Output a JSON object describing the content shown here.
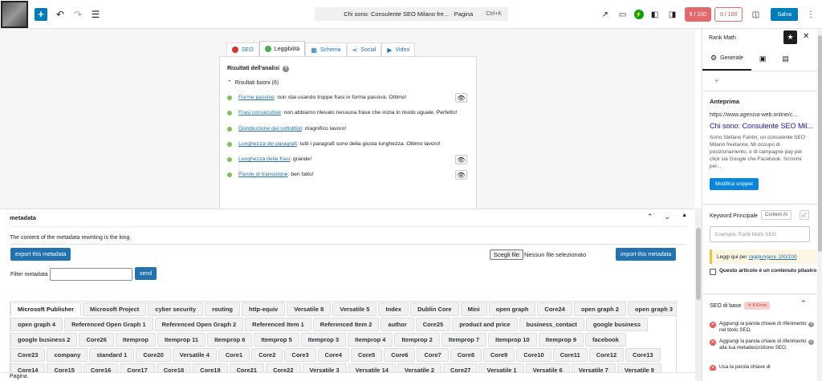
{
  "topbar": {
    "doc_title": "Chi sono: Consulente SEO Milano fre... · Pagina",
    "shortcut": "Ctrl+K",
    "seo_score": "9 / 100",
    "read_score": "0 / 100",
    "save_label": "Salva"
  },
  "analysis": {
    "tabs": [
      {
        "label": "SEO"
      },
      {
        "label": "Leggibilità"
      },
      {
        "label": "Schema"
      },
      {
        "label": "Social"
      },
      {
        "label": "Video"
      }
    ],
    "title": "Risultati dell'analisi",
    "group": "Risultati buoni (6)",
    "results": [
      {
        "link": "Forme passive",
        "text": ": non stai usando troppe frasi in forma passiva. Ottimo!"
      },
      {
        "link": "Frasi consecutive",
        "text": ": non abbiamo rilevato nessuna frase che inizia in modo uguale. Perfetto!"
      },
      {
        "link": "Distribuzione dei sottotitoli",
        "text": ": magnifico lavoro!"
      },
      {
        "link": "Lunghezza dei paragrafi",
        "text": ": tutti i paragrafi sono della giusta lunghezza. Ottimo lavoro!"
      },
      {
        "link": "Lunghezza delle frasi",
        "text": ": grande!"
      },
      {
        "link": "Parole di transizione",
        "text": ": ben fatto!"
      }
    ]
  },
  "metabox": {
    "title": "metadata",
    "description": "The content of the metadata rewriting is the king.",
    "export_label": "export this metadata",
    "file_button": "Scegli file",
    "file_text": "Nessun file selezionato",
    "import_label": "import this metadata",
    "filter_label": "Filter metadata",
    "send_label": "send",
    "tag_rows": [
      [
        "Microsoft Publisher",
        "Microsoft Project",
        "cyber security",
        "routing",
        "http-equiv",
        "Versatile 8",
        "Versatile 5",
        "Index",
        "Dublin Core",
        "Mini",
        "open graph",
        "Core24",
        "open graph 2",
        "open graph 3"
      ],
      [
        "open graph 4",
        "Referenced Open Graph 1",
        "Referenced Open Graph 2",
        "Referenced Item 1",
        "Referenced Item 2",
        "author",
        "Core25",
        "product and price",
        "business_contact",
        "google business"
      ],
      [
        "google business 2",
        "Core26",
        "Itemprop",
        "Itemprop 11",
        "Itemprop 6",
        "Itemprop 5",
        "Itemprop 3",
        "Itemprop 4",
        "Itemprop 2",
        "Itemprop 7",
        "Itemprop 10",
        "Itemprop 9",
        "facebook"
      ],
      [
        "Core23",
        "company",
        "standard 1",
        "Core20",
        "Versatile 4",
        "Core1",
        "Core2",
        "Core3",
        "Core4",
        "Core5",
        "Core6",
        "Core7",
        "Core8",
        "Core9",
        "Core10",
        "Core11",
        "Core12",
        "Core13"
      ],
      [
        "Core14",
        "Core15",
        "Core16",
        "Core17",
        "Core18",
        "Core19",
        "Core21",
        "Core22",
        "Versatile 3",
        "Versatile 14",
        "Versatile 2",
        "Core27",
        "Versatile 1",
        "Versatile 6",
        "Versatile 7",
        "Versatile 9"
      ]
    ]
  },
  "statusbar": {
    "label": "Pagina"
  },
  "sidebar": {
    "title": "Rank Math",
    "tab_general": "Generale",
    "preview_title": "Anteprima",
    "preview_url": "https://www.agenzia-web.online/c...",
    "preview_heading": "Chi sono: Consulente SEO Mil...",
    "preview_desc": "Sono Stefano Fantin, un consulente SEO Milano freelance. Mi occupo di posizionamento, e di campagne pay per click sia Google che Facebook. Scrivimi per...",
    "modify_label": "Modifica snippet",
    "kw_label": "Keyword Principale",
    "content_ai": "Content AI",
    "kw_placeholder": "Esempio: Rank Math SEO",
    "notice_text": "Leggi qui per",
    "notice_link": "raggiungere 100/100",
    "pillar_text": "Questo articolo è un contenuto pilastro",
    "basic_title": "SEO di base",
    "basic_errors": "✕ 8 Errori",
    "checks": [
      "Aggiungi la parola chiave di riferimento nel titolo SEO.",
      "Aggiungi la parola chiave di riferimento alla tua metadescrizione SEO.",
      "Usa la parola chiave di"
    ]
  },
  "colors": {
    "primary": "#007cba",
    "seo_score_bg": "#e5686c",
    "good": "#79c453"
  }
}
